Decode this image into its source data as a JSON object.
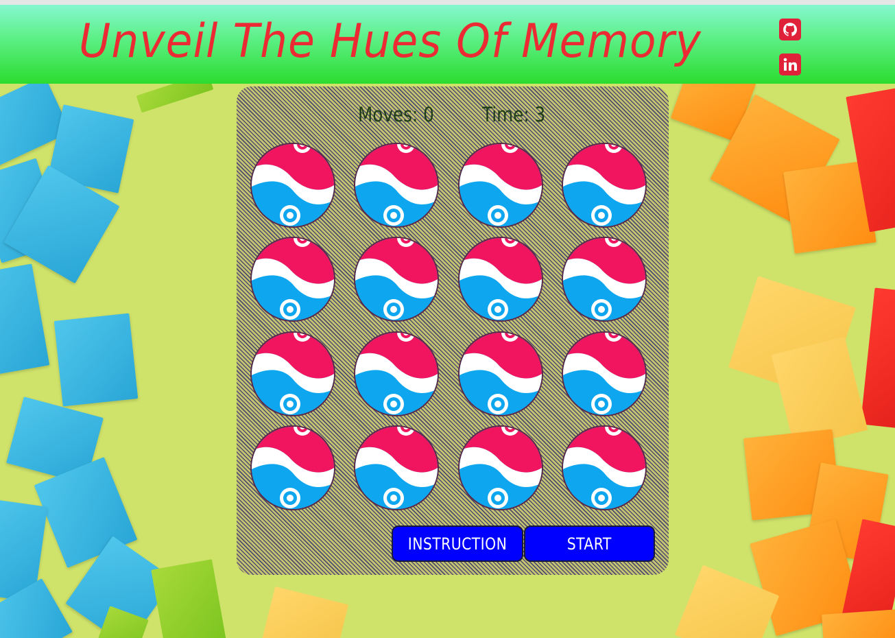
{
  "header": {
    "title": "Unveil The Hues Of Memory",
    "accent_color": "#ec2a33",
    "gradient_colors": [
      "#86f7d0",
      "#2bdc2f"
    ],
    "links": [
      {
        "icon": "github-icon"
      },
      {
        "icon": "linkedin-icon"
      }
    ]
  },
  "game": {
    "moves_label": "Moves: 0",
    "time_label": "Time: 3",
    "card_back_colors": [
      "#f0155e",
      "#ffffff",
      "#0ea6ef"
    ],
    "rows": 4,
    "columns": 4
  },
  "buttons": {
    "instruction_label": "INSTRUCTION",
    "start_label": "START",
    "button_color": "#0000ff"
  }
}
